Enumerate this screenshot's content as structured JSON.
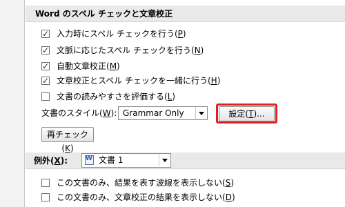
{
  "section_spelling": {
    "title": "Word のスペル チェックと文章校正",
    "options": [
      {
        "text": "入力時にスペル チェックを行う(",
        "key": "P",
        "end": ")",
        "checked": true
      },
      {
        "text": "文脈に応じたスペル チェックを行う(",
        "key": "N",
        "end": ")",
        "checked": true
      },
      {
        "text": "自動文章校正(",
        "key": "M",
        "end": ")",
        "checked": true
      },
      {
        "text": "文章校正とスペル チェックを一緒に行う(",
        "key": "H",
        "end": ")",
        "checked": true
      },
      {
        "text": "文書の読みやすさを評価する(",
        "key": "L",
        "end": ")",
        "checked": false
      }
    ],
    "style_label_pre": "文書のスタイル(",
    "style_label_key": "W",
    "style_label_post": "):",
    "style_value": "Grammar Only",
    "settings_button_pre": "設定(",
    "settings_button_key": "T",
    "settings_button_post": ")...",
    "recheck_button_pre": "再チェック(",
    "recheck_button_key": "K",
    "recheck_button_post": ")",
    "highlight_color": "#e02020"
  },
  "section_exceptions": {
    "label_pre": "例外(",
    "label_key": "X",
    "label_post": "):",
    "document_value": "文書 1",
    "options": [
      {
        "text": "この文書のみ、結果を表す波線を表示しない(",
        "key": "S",
        "end": ")",
        "checked": false
      },
      {
        "text": "この文書のみ、文章校正の結果を表示しない(",
        "key": "D",
        "end": ")",
        "checked": false
      }
    ]
  }
}
